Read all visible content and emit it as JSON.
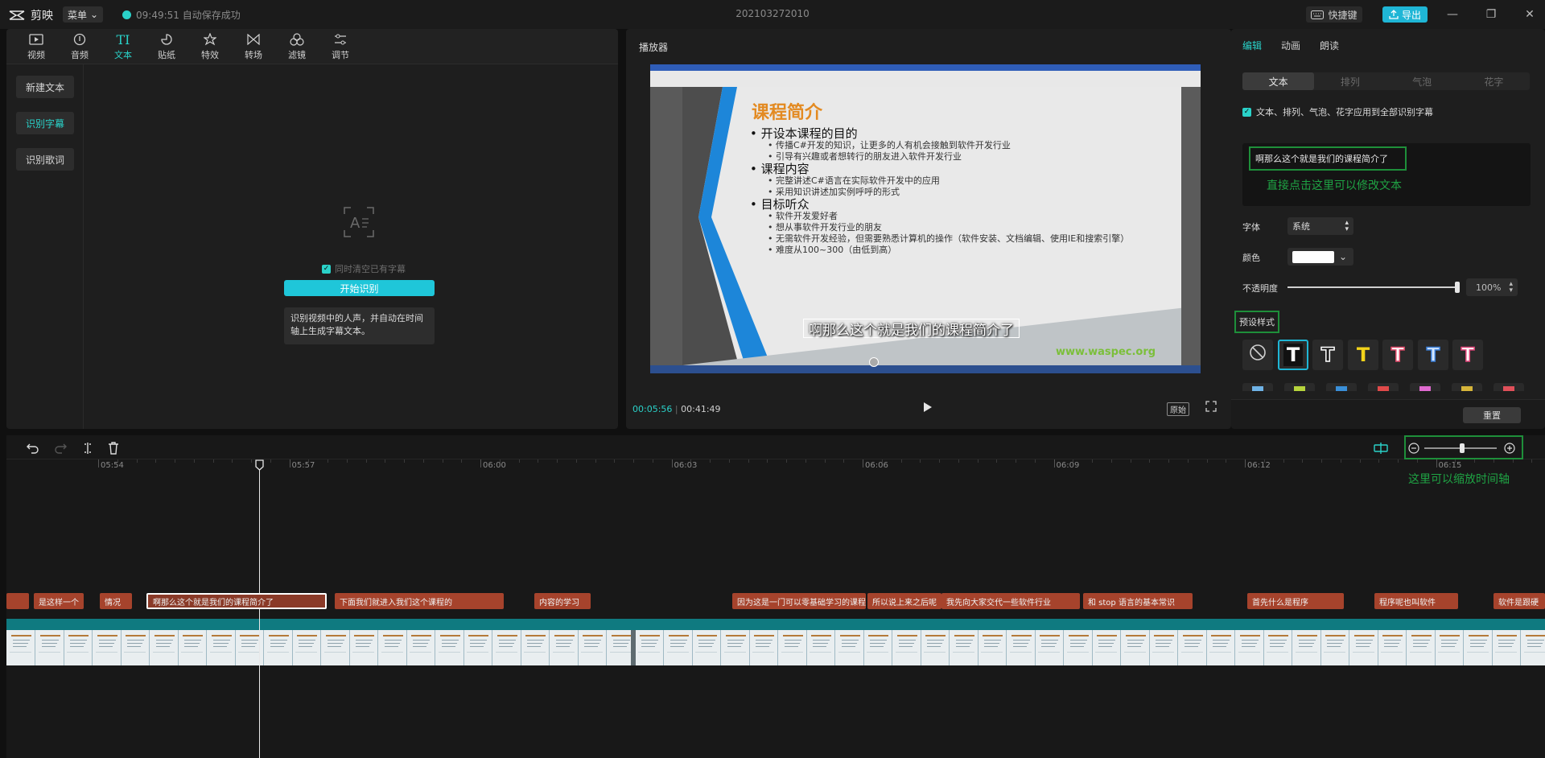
{
  "app": {
    "name": "剪映",
    "menu_label": "菜单",
    "save_status": "09:49:51 自动保存成功",
    "project_title": "202103272010",
    "shortcut_label": "快捷键",
    "export_label": "导出"
  },
  "toolbar": {
    "items": [
      {
        "label": "视频",
        "icon": "video-icon"
      },
      {
        "label": "音频",
        "icon": "audio-icon"
      },
      {
        "label": "文本",
        "icon": "text-icon",
        "active": true
      },
      {
        "label": "贴纸",
        "icon": "sticker-icon"
      },
      {
        "label": "特效",
        "icon": "effects-icon"
      },
      {
        "label": "转场",
        "icon": "transition-icon"
      },
      {
        "label": "滤镜",
        "icon": "filter-icon"
      },
      {
        "label": "调节",
        "icon": "adjust-icon"
      }
    ]
  },
  "subnav": {
    "items": [
      "新建文本",
      "识别字幕",
      "识别歌词"
    ],
    "active_index": 1
  },
  "recognition": {
    "keep_existing_label": "同时清空已有字幕",
    "start_button": "开始识别",
    "tip": "识别视频中的人声，并自动在时间轴上生成字幕文本。"
  },
  "player": {
    "title": "播放器",
    "current_time": "00:05:56",
    "total_time": "00:41:49",
    "ratio_label": "原始",
    "subtitle": "啊那么这个就是我们的课程简介了",
    "slide": {
      "title": "课程简介",
      "bullets": [
        {
          "text": "开设本课程的目的",
          "subs": [
            "传播C#开发的知识，让更多的人有机会接触到软件开发行业",
            "引导有兴趣或者想转行的朋友进入软件开发行业"
          ]
        },
        {
          "text": "课程内容",
          "subs": [
            "完整讲述C#语言在实际软件开发中的应用",
            "采用知识讲述加实例呼呼的形式"
          ]
        },
        {
          "text": "目标听众",
          "subs": [
            "软件开发爱好者",
            "想从事软件开发行业的朋友",
            "无需软件开发经验，但需要熟悉计算机的操作（软件安装、文档编辑、使用IE和搜索引擎）",
            "难度从100~300（由低到高）"
          ]
        }
      ],
      "watermark": "www.waspec.org"
    }
  },
  "right": {
    "tabs": [
      "编辑",
      "动画",
      "朗读"
    ],
    "segments": [
      "文本",
      "排列",
      "气泡",
      "花字"
    ],
    "apply_all_label": "文本、排列、气泡、花字应用到全部识别字幕",
    "text_value": "啊那么这个就是我们的课程简介了",
    "edit_annotation": "直接点击这里可以修改文本",
    "font_label": "字体",
    "font_value": "系统",
    "color_label": "颜色",
    "color_value": "#ffffff",
    "opacity_label": "不透明度",
    "opacity_value": "100%",
    "opacity_fraction": 1.0,
    "preset_label": "预设样式",
    "reset_label": "重置",
    "presets": [
      {
        "glyph": "⃠",
        "color": "#cfcfcf",
        "icon": "none-icon"
      },
      {
        "glyph": "T",
        "color": "#ffffff"
      },
      {
        "glyph": "T",
        "color": "#1a1a1a",
        "stroke": "#ffffff"
      },
      {
        "glyph": "T",
        "color": "#f3d31a"
      },
      {
        "glyph": "T",
        "color": "#ffffff",
        "stroke": "#e24a6a"
      },
      {
        "glyph": "T",
        "color": "#d7e9ff",
        "stroke": "#3b7fd9"
      },
      {
        "glyph": "T",
        "color": "#ffffff",
        "stroke": "#e0457a"
      }
    ]
  },
  "timeline": {
    "ruler_labels": [
      "05:54",
      "05:57",
      "06:00",
      "06:03",
      "06:06",
      "06:09",
      "06:12",
      "06:15"
    ],
    "zoom_annotation": "这里可以缩放时间轴",
    "clips": [
      {
        "text": ""
      },
      {
        "text": "是这样一个"
      },
      {
        "text": "情况"
      },
      {
        "text": "啊那么这个就是我们的课程简介了",
        "selected": true
      },
      {
        "text": "下面我们就进入我们这个课程的"
      },
      {
        "text": "内容的学习"
      },
      {
        "text": "因为这是一门可以零基础学习的课程"
      },
      {
        "text": "所以说上来之后呢"
      },
      {
        "text": "我先向大家交代一些软件行业"
      },
      {
        "text": "和 stop 语言的基本常识"
      },
      {
        "text": "首先什么是程序"
      },
      {
        "text": "程序呢也叫软件"
      },
      {
        "text": "软件是跟硬"
      }
    ]
  },
  "colors": {
    "accent": "#2ad2c9",
    "export": "#1fb6d6",
    "annotation": "#1fa344",
    "clip": "#a6432c"
  }
}
